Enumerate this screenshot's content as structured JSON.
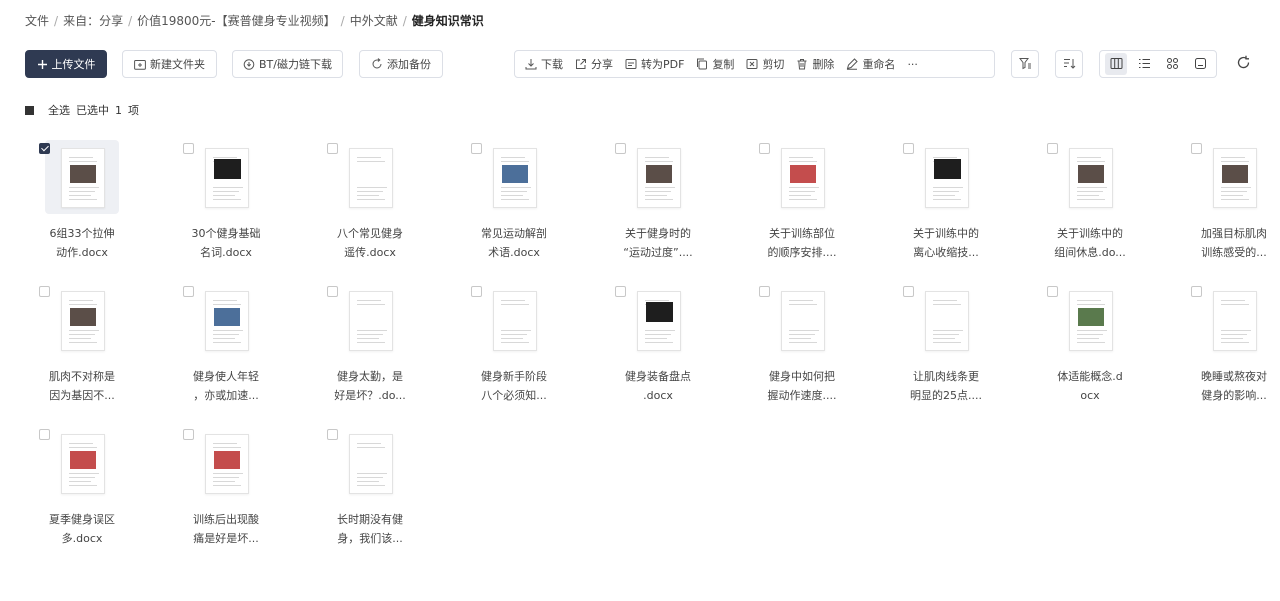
{
  "breadcrumb": [
    {
      "label": "文件"
    },
    {
      "label": "来自：分享"
    },
    {
      "label": "价值19800元-【赛普健身专业视频】"
    },
    {
      "label": "中外文献"
    },
    {
      "label": "健身知识常识"
    }
  ],
  "toolbar": {
    "upload_label": "上传文件",
    "new_folder_label": "新建文件夹",
    "bt_label": "BT/磁力链下载",
    "backup_label": "添加备份",
    "download_label": "下载",
    "share_label": "分享",
    "topdf_label": "转为PDF",
    "copy_label": "复制",
    "cut_label": "剪切",
    "delete_label": "删除",
    "rename_label": "重命名",
    "more_label": "···"
  },
  "selection": {
    "select_all_label": "全选",
    "status_prefix": "已选中",
    "count": "1",
    "unit": "项"
  },
  "colors": {
    "primary": "#2f3a52",
    "selected_tile": "#eef0f4"
  },
  "files": [
    {
      "line1": "6组33个拉伸",
      "line2": "动作.docx",
      "selected": true,
      "thumb": "photo"
    },
    {
      "line1": "30个健身基础",
      "line2": "名词.docx",
      "selected": false,
      "thumb": "dark"
    },
    {
      "line1": "八个常见健身",
      "line2": "遥传.docx",
      "selected": false,
      "thumb": "text"
    },
    {
      "line1": "常见运动解剖",
      "line2": "术语.docx",
      "selected": false,
      "thumb": "blue"
    },
    {
      "line1": "关于健身时的",
      "line2": "“运动过度”....",
      "selected": false,
      "thumb": "photo"
    },
    {
      "line1": "关于训练部位",
      "line2": "的顺序安排....",
      "selected": false,
      "thumb": "red"
    },
    {
      "line1": "关于训练中的",
      "line2": "离心收缩技...",
      "selected": false,
      "thumb": "dark"
    },
    {
      "line1": "关于训练中的",
      "line2": "组间休息.do...",
      "selected": false,
      "thumb": "photo"
    },
    {
      "line1": "加强目标肌肉",
      "line2": "训练感受的...",
      "selected": false,
      "thumb": "photo"
    },
    {
      "line1": "肌肉不对称是",
      "line2": "因为基因不...",
      "selected": false,
      "thumb": "photo"
    },
    {
      "line1": "健身使人年轻",
      "line2": "，亦或加速...",
      "selected": false,
      "thumb": "blue"
    },
    {
      "line1": "健身太勤，是",
      "line2": "好是坏？.do...",
      "selected": false,
      "thumb": "text"
    },
    {
      "line1": "健身新手阶段",
      "line2": "八个必须知...",
      "selected": false,
      "thumb": "text"
    },
    {
      "line1": "健身装备盘点",
      "line2": ".docx",
      "selected": false,
      "thumb": "dark"
    },
    {
      "line1": "健身中如何把",
      "line2": "握动作速度....",
      "selected": false,
      "thumb": "text"
    },
    {
      "line1": "让肌肉线条更",
      "line2": "明显的25点....",
      "selected": false,
      "thumb": "text"
    },
    {
      "line1": "体适能概念.d",
      "line2": "ocx",
      "selected": false,
      "thumb": "green"
    },
    {
      "line1": "晚睡或熬夜对",
      "line2": "健身的影响...",
      "selected": false,
      "thumb": "text"
    },
    {
      "line1": "夏季健身误区",
      "line2": "多.docx",
      "selected": false,
      "thumb": "red"
    },
    {
      "line1": "训练后出现酸",
      "line2": "痛是好是坏...",
      "selected": false,
      "thumb": "red"
    },
    {
      "line1": "长时期没有健",
      "line2": "身，我们该...",
      "selected": false,
      "thumb": "text"
    }
  ]
}
